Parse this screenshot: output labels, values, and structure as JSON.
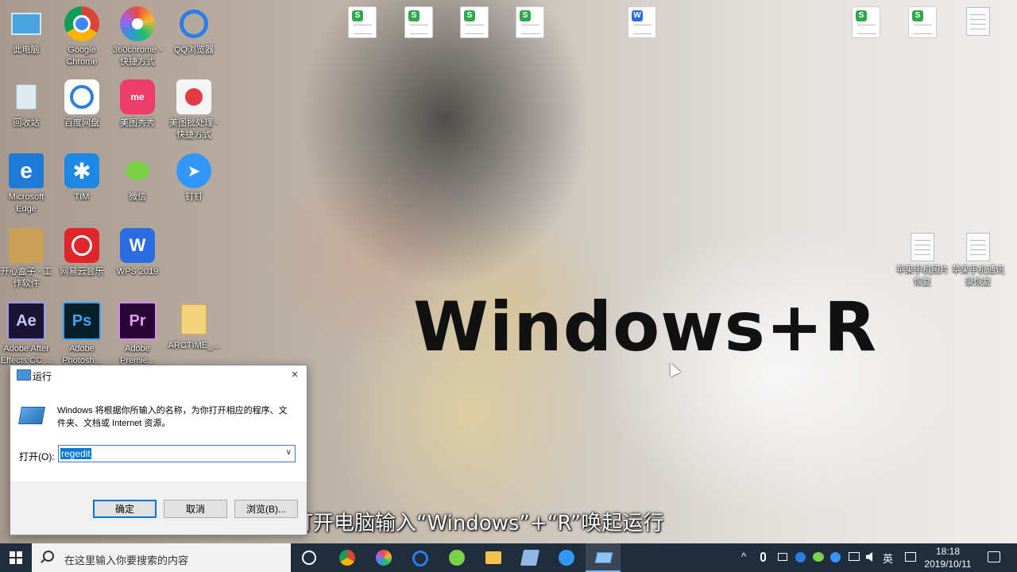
{
  "desktop": {
    "icons": [
      {
        "label": "此电脑",
        "icon": "this-pc-icon"
      },
      {
        "label": "Google Chrome",
        "icon": "chrome-icon"
      },
      {
        "label": "360chrome - 快捷方式",
        "icon": "360chrome-icon"
      },
      {
        "label": "QQ浏览器",
        "icon": "qq-browser-icon"
      },
      {
        "label": "回收站",
        "icon": "recycle-bin-icon"
      },
      {
        "label": "百度网盘",
        "icon": "baidu-netdisk-icon"
      },
      {
        "label": "美图秀秀",
        "icon": "meitu-icon"
      },
      {
        "label": "美图批处理 - 快捷方式",
        "icon": "meitu-batch-icon"
      },
      {
        "label": "Microsoft Edge",
        "icon": "edge-icon"
      },
      {
        "label": "TIM",
        "icon": "tim-icon"
      },
      {
        "label": "微信",
        "icon": "wechat-icon"
      },
      {
        "label": "钉钉",
        "icon": "dingtalk-icon"
      },
      {
        "label": "开心盒子 - 工作软件",
        "icon": "box-icon"
      },
      {
        "label": "网易云音乐",
        "icon": "netease-music-icon"
      },
      {
        "label": "WPS 2019",
        "icon": "wps-icon"
      },
      {
        "label": "Adobe After Effects CC ...",
        "icon": "after-effects-icon"
      },
      {
        "label": "Adobe Photosh...",
        "icon": "photoshop-icon"
      },
      {
        "label": "Adobe Premie...",
        "icon": "premiere-icon"
      },
      {
        "label": "ARCTIME_...",
        "icon": "folder-icon"
      }
    ],
    "right_files": [
      {
        "label": "苹果手机照片恢复"
      },
      {
        "label": "苹果手机通讯录恢复"
      }
    ],
    "overlay_title": "Windows+R",
    "subtitle": "打开电脑输入“Windows”+“R”唤起运行"
  },
  "run_dialog": {
    "title": "运行",
    "close": "×",
    "description": "Windows 将根据你所输入的名称，为你打开相应的程序、文件夹、文档或 Internet 资源。",
    "open_label": "打开(O):",
    "input_value": "regedit",
    "dropdown": "∨",
    "ok": "确定",
    "cancel": "取消",
    "browse": "浏览(B)..."
  },
  "taskbar": {
    "search_placeholder": "在这里输入你要搜索的内容",
    "ime": "英",
    "time": "18:18",
    "date": "2019/10/11",
    "tray_arrow": "^"
  }
}
